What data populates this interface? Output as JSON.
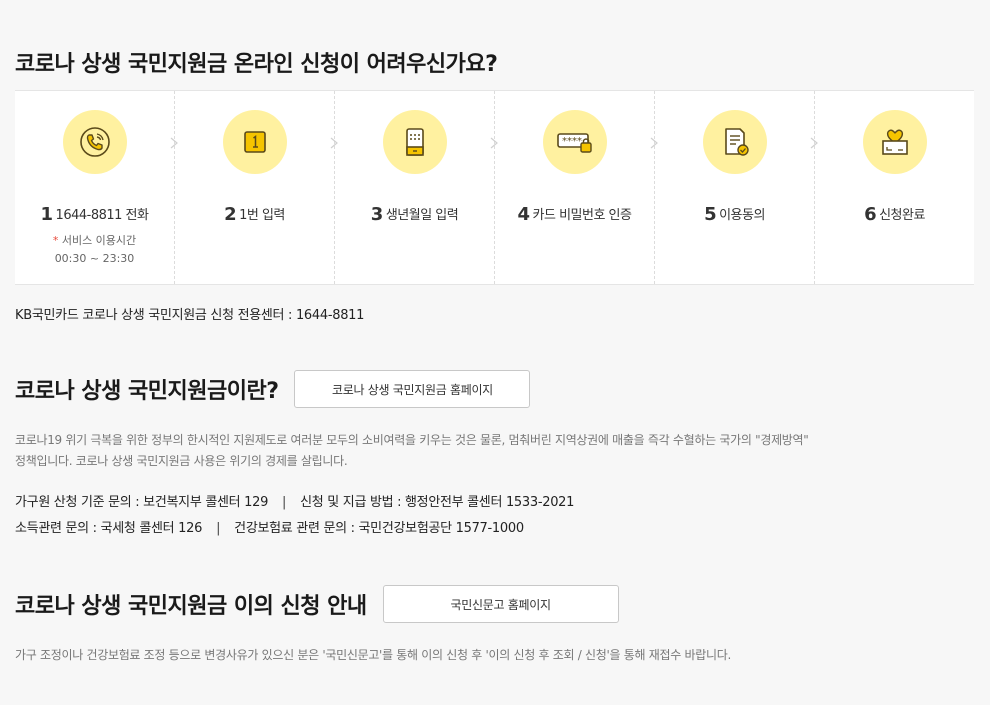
{
  "section1": {
    "title": "코로나 상생 국민지원금 온라인 신청이 어려우신가요?",
    "steps": [
      {
        "num": "1",
        "label": "1644-8811 전화",
        "icon": "phone-icon",
        "sub_star": "*",
        "sub_line1": "서비스 이용시간",
        "sub_line2": "00:30 ~ 23:30"
      },
      {
        "num": "2",
        "label": "1번 입력",
        "icon": "keypad-one-icon"
      },
      {
        "num": "3",
        "label": "생년월일 입력",
        "icon": "phone-keypad-icon"
      },
      {
        "num": "4",
        "label": "카드 비밀번호 인증",
        "icon": "password-lock-icon"
      },
      {
        "num": "5",
        "label": "이용동의",
        "icon": "document-check-icon"
      },
      {
        "num": "6",
        "label": "신청완료",
        "icon": "heart-box-icon"
      }
    ],
    "center_info": "KB국민카드 코로나 상생 국민지원금 신청 전용센터 : 1644-8811"
  },
  "section2": {
    "title": "코로나 상생 국민지원금이란?",
    "button_label": "코로나 상생 국민지원금 홈페이지",
    "description_line1": "코로나19 위기 극복을 위한 정부의 한시적인 지원제도로 여러분 모두의 소비여력을 키우는 것은 물론, 멈춰버린 지역상권에 매출을 즉각 수혈하는 국가의 \"경제방역\"",
    "description_line2": "정책입니다. 코로나 상생 국민지원금 사용은 위기의 경제를 살립니다.",
    "contacts": {
      "row1_a": "가구원 산청 기준 문의 : 보건복지부 콜센터 129",
      "row1_b": "신청 및 지급 방법 : 행정안전부 콜센터 1533-2021",
      "row2_a": "소득관련 문의 : 국세청 콜센터 126",
      "row2_b": "건강보험료 관련 문의 : 국민건강보험공단 1577-1000",
      "separator": "|"
    }
  },
  "section3": {
    "title": "코로나 상생 국민지원금 이의 신청 안내",
    "button_label": "국민신문고 홈페이지",
    "description": "가구 조정이나 건강보험료 조정 등으로 변경사유가 있으신 분은 '국민신문고'를 통해 이의 신청 후 '이의 신청 후 조회 / 신청'을 통해 재접수 바랍니다."
  },
  "colors": {
    "icon_circle": "#fff1a0",
    "icon_accent": "#f5c400",
    "icon_stroke": "#5a4a1a"
  }
}
